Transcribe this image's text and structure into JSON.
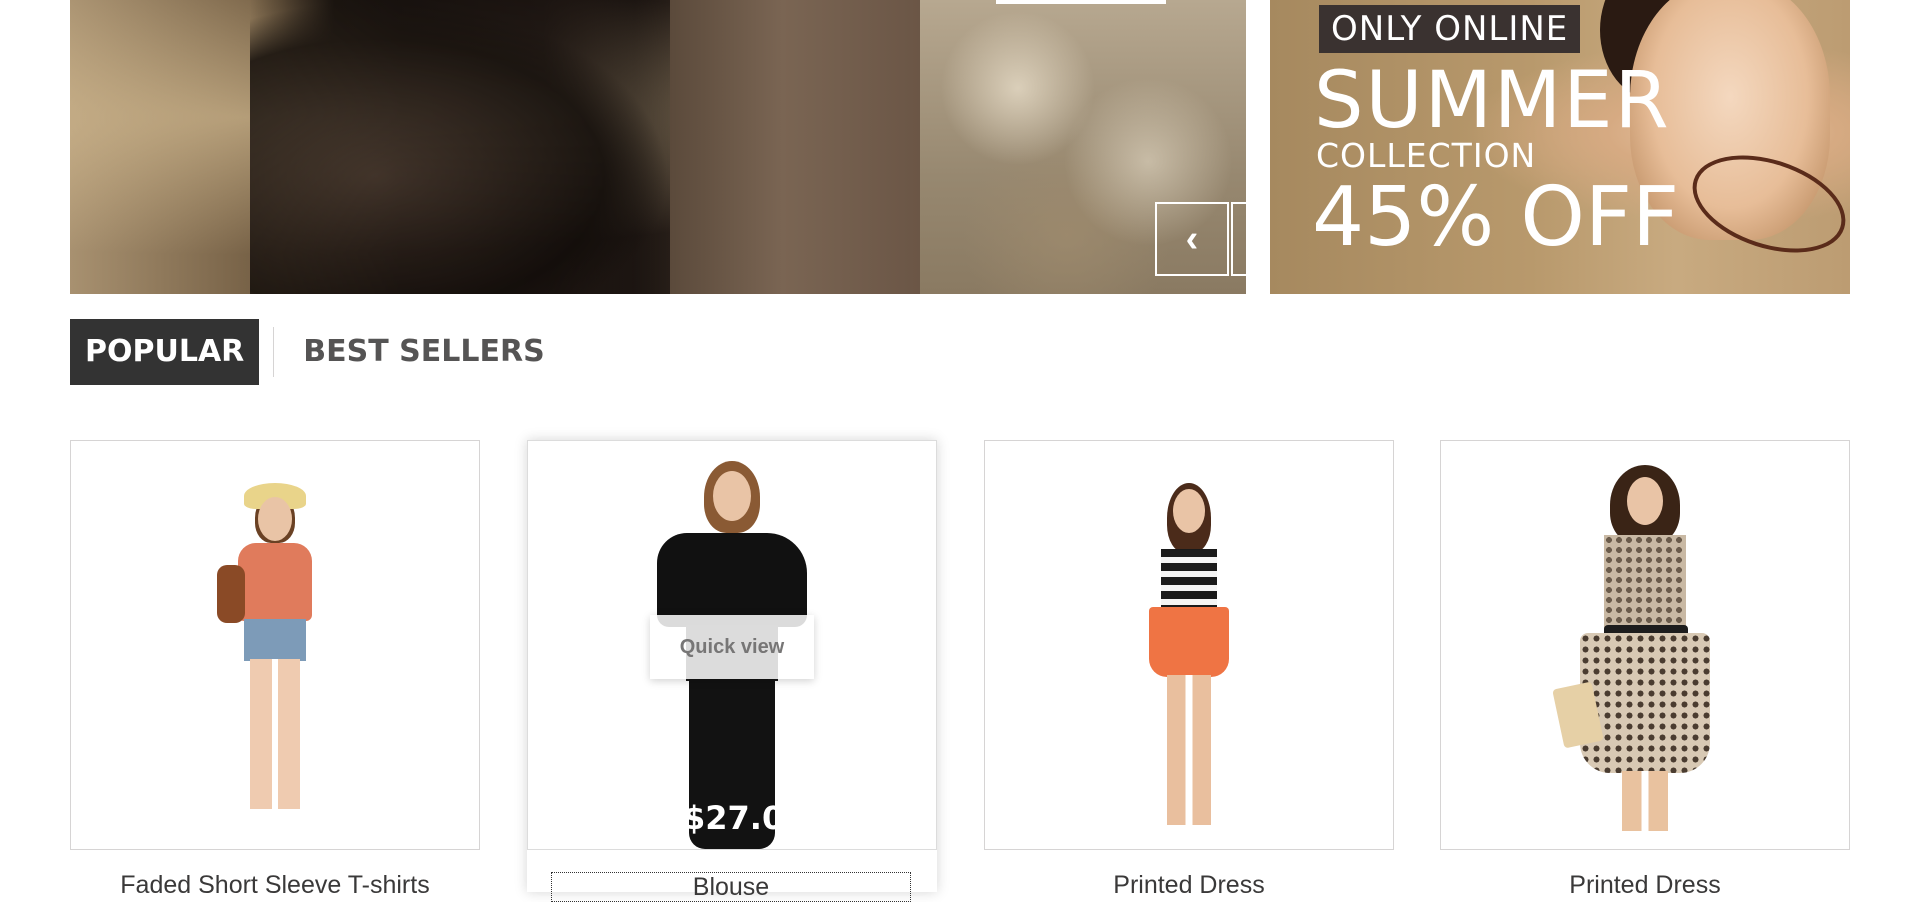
{
  "slider": {
    "prev_icon": "chevron-left-icon",
    "next_icon": "chevron-right-icon",
    "prev_glyph": "‹",
    "next_glyph": "›"
  },
  "promo": {
    "badge": "ONLY ONLINE",
    "headline": "SUMMER",
    "subline": "COLLECTION",
    "discount": "45% OFF"
  },
  "tabs": [
    {
      "label": "POPULAR",
      "active": true
    },
    {
      "label": "BEST SELLERS",
      "active": false
    }
  ],
  "products": [
    {
      "name": "Faded Short Sleeve T-shirts"
    },
    {
      "name": "Blouse",
      "hovered": true,
      "quick_view_label": "Quick view",
      "price": "$27.00"
    },
    {
      "name": "Printed Dress"
    },
    {
      "name": "Printed Dress"
    }
  ],
  "colors": {
    "tab_active_bg": "#333333",
    "tab_text": "#555454",
    "border": "#d6d4d4"
  }
}
